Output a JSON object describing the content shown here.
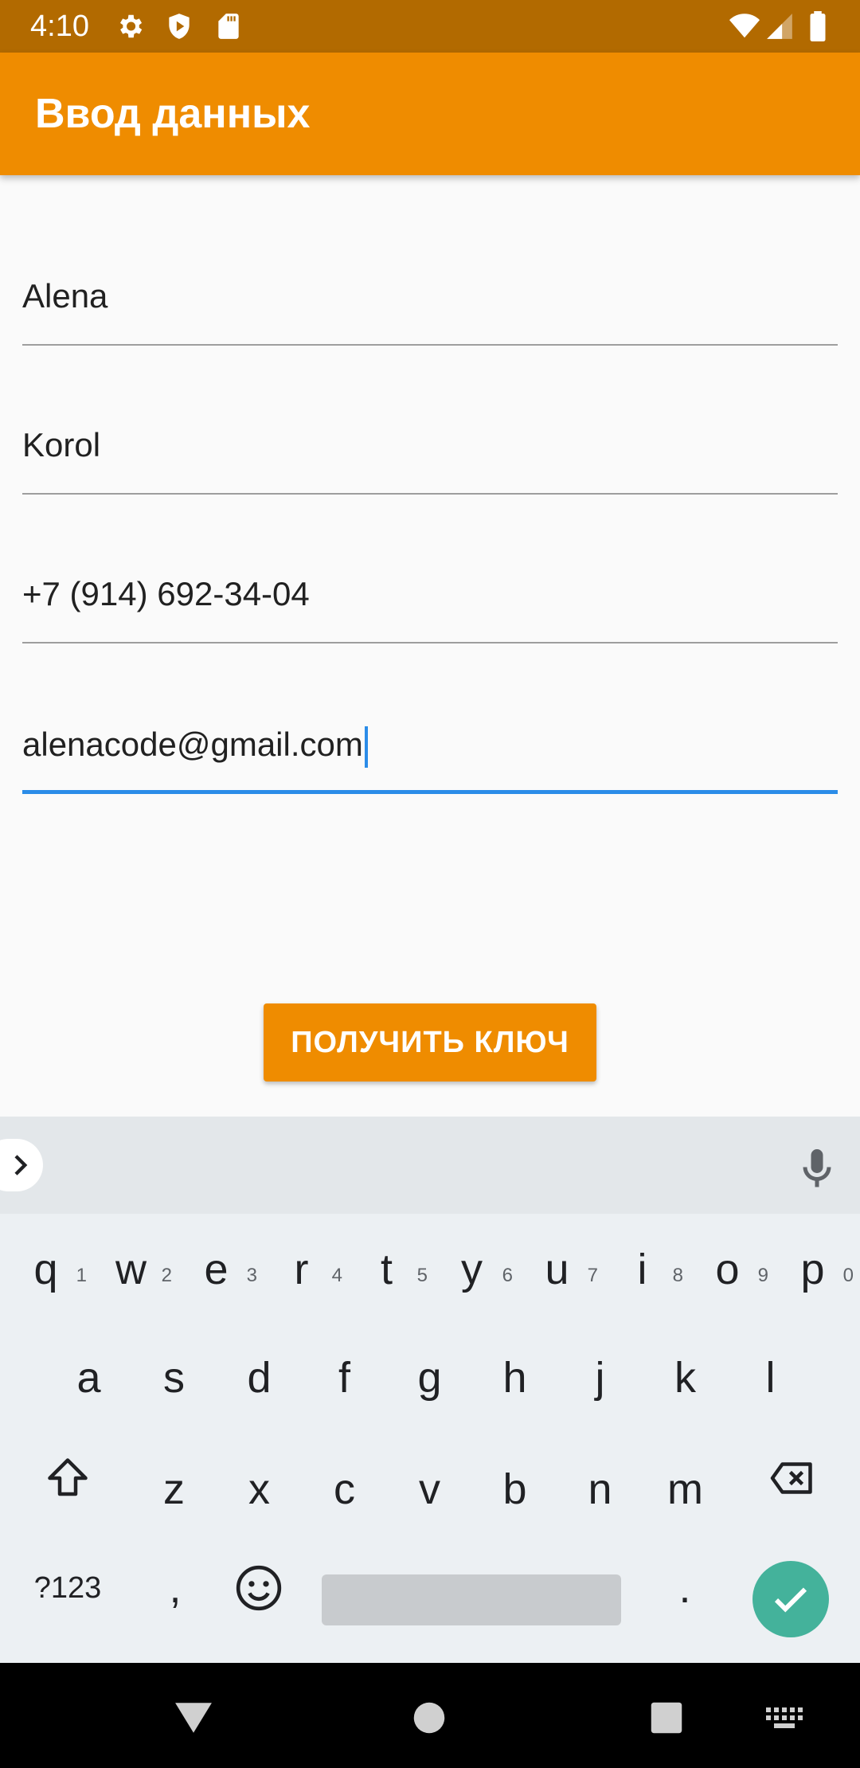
{
  "status_bar": {
    "time": "4:10",
    "left_icons": [
      "gear-icon",
      "shield-play-icon",
      "sd-card-icon"
    ],
    "right_icons": [
      "wifi-icon",
      "signal-icon",
      "battery-icon"
    ]
  },
  "app_bar": {
    "title": "Ввод данных",
    "color": "#ef8c00"
  },
  "form": {
    "first_name": "Alena",
    "last_name": "Korol",
    "phone": "+7 (914) 692-34-04",
    "email": "alenacode@gmail.com"
  },
  "button": {
    "label": "ПОЛУЧИТЬ КЛЮЧ"
  },
  "keyboard": {
    "row1": [
      {
        "key": "q",
        "hint": "1"
      },
      {
        "key": "w",
        "hint": "2"
      },
      {
        "key": "e",
        "hint": "3"
      },
      {
        "key": "r",
        "hint": "4"
      },
      {
        "key": "t",
        "hint": "5"
      },
      {
        "key": "y",
        "hint": "6"
      },
      {
        "key": "u",
        "hint": "7"
      },
      {
        "key": "i",
        "hint": "8"
      },
      {
        "key": "o",
        "hint": "9"
      },
      {
        "key": "p",
        "hint": "0"
      }
    ],
    "row2": [
      "a",
      "s",
      "d",
      "f",
      "g",
      "h",
      "j",
      "k",
      "l"
    ],
    "row3": [
      "z",
      "x",
      "c",
      "v",
      "b",
      "n",
      "m"
    ],
    "symbols_label": "?123",
    "comma": ",",
    "period": "."
  }
}
